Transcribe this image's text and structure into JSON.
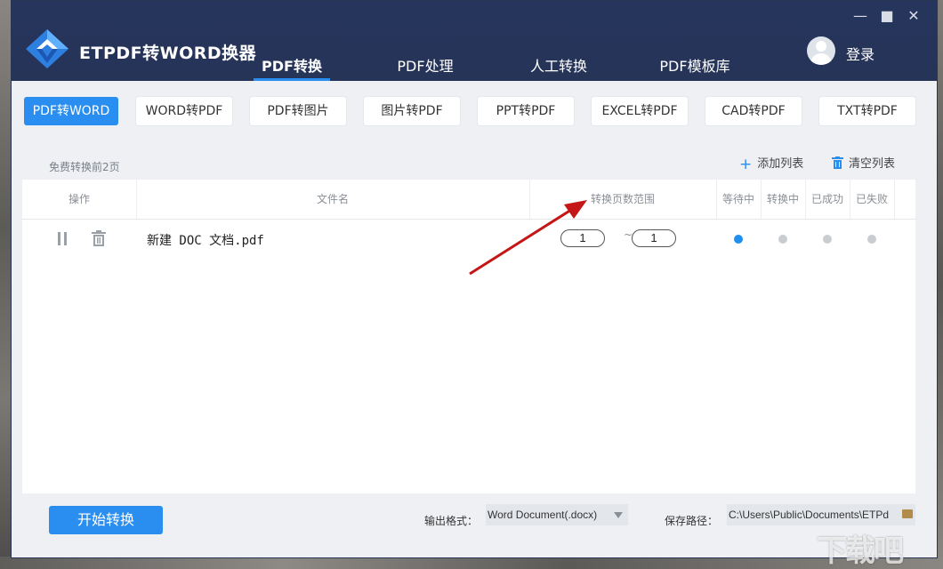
{
  "app": {
    "title": "ETPDF转WORD换器",
    "login_label": "登录",
    "brand_color": "#2a8ef0"
  },
  "window_controls": {
    "minimize": "—",
    "maximize": "■",
    "close": "✕"
  },
  "nav": {
    "items": [
      {
        "label": "PDF转换",
        "active": true
      },
      {
        "label": "PDF处理",
        "active": false
      },
      {
        "label": "人工转换",
        "active": false
      },
      {
        "label": "PDF模板库",
        "active": false
      }
    ]
  },
  "tools": [
    {
      "label": "PDF转WORD",
      "active": true
    },
    {
      "label": "WORD转PDF",
      "active": false
    },
    {
      "label": "PDF转图片",
      "active": false
    },
    {
      "label": "图片转PDF",
      "active": false
    },
    {
      "label": "PPT转PDF",
      "active": false
    },
    {
      "label": "EXCEL转PDF",
      "active": false
    },
    {
      "label": "CAD转PDF",
      "active": false
    },
    {
      "label": "TXT转PDF",
      "active": false
    }
  ],
  "list": {
    "free_note": "免费转换前2页",
    "add_label": "添加列表",
    "clear_label": "清空列表",
    "columns": {
      "action": "操作",
      "filename": "文件名",
      "page_range": "转换页数范围",
      "waiting": "等待中",
      "converting": "转换中",
      "success": "已成功",
      "failed": "已失败"
    },
    "rows": [
      {
        "filename": "新建 DOC 文档.pdf",
        "page_from": "1",
        "page_separator": "~",
        "page_to": "1",
        "status": "waiting"
      }
    ]
  },
  "footer": {
    "start_label": "开始转换",
    "output_format_label": "输出格式：",
    "output_format_value": "Word Document(.docx)",
    "save_path_label": "保存路径：",
    "save_path_value": "C:\\Users\\Public\\Documents\\ETPd"
  },
  "watermark": "下载吧"
}
